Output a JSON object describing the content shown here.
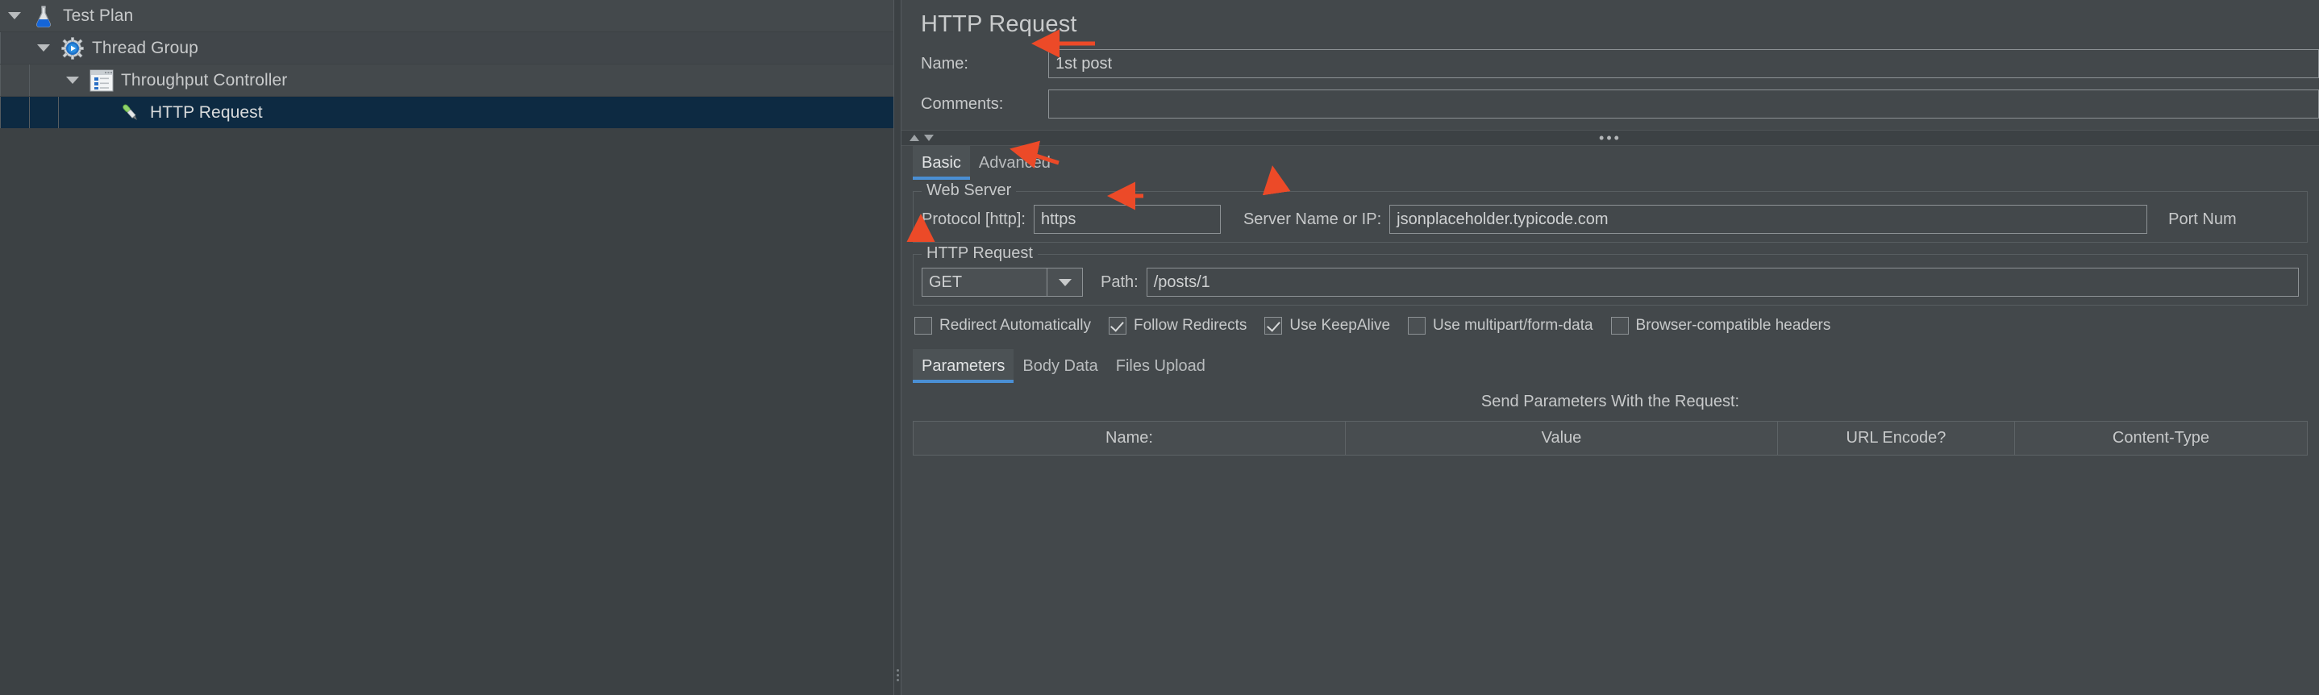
{
  "tree": {
    "name": "test-plan-tree",
    "nodes": [
      {
        "label": "Test Plan",
        "icon": "flask-icon",
        "depth": 0,
        "expanded": true,
        "selected": false
      },
      {
        "label": "Thread Group",
        "icon": "thread-group-gear-icon",
        "depth": 1,
        "expanded": true,
        "selected": false
      },
      {
        "label": "Throughput Controller",
        "icon": "throughput-controller-icon",
        "depth": 2,
        "expanded": true,
        "selected": false
      },
      {
        "label": "HTTP Request",
        "icon": "http-request-pipette-icon",
        "depth": 3,
        "expanded": false,
        "selected": true
      }
    ]
  },
  "panel": {
    "title": "HTTP Request",
    "name_label": "Name:",
    "name_value": "1st post",
    "name_placeholder": "",
    "comments_label": "Comments:",
    "comments_value": "",
    "comments_placeholder": "",
    "tabs": [
      {
        "label": "Basic",
        "active": true
      },
      {
        "label": "Advanced",
        "active": false
      }
    ],
    "web_server": {
      "legend": "Web Server",
      "protocol_label": "Protocol [http]:",
      "protocol_value": "https",
      "server_label": "Server Name or IP:",
      "server_value": "jsonplaceholder.typicode.com",
      "port_label": "Port Num"
    },
    "http_request": {
      "legend": "HTTP Request",
      "method_value": "GET",
      "path_label": "Path:",
      "path_value": "/posts/1"
    },
    "checkboxes": [
      {
        "label": "Redirect Automatically",
        "checked": false
      },
      {
        "label": "Follow Redirects",
        "checked": true
      },
      {
        "label": "Use KeepAlive",
        "checked": true
      },
      {
        "label": "Use multipart/form-data",
        "checked": false
      },
      {
        "label": "Browser-compatible headers",
        "checked": false
      }
    ],
    "body_tabs": [
      {
        "label": "Parameters",
        "active": true
      },
      {
        "label": "Body Data",
        "active": false
      },
      {
        "label": "Files Upload",
        "active": false
      }
    ],
    "params_table": {
      "caption": "Send Parameters With the Request:",
      "columns": [
        "Name:",
        "Value",
        "URL Encode?",
        "Content-Type"
      ],
      "rows": []
    }
  },
  "annotations": {
    "color": "#ec4a28",
    "arrows": [
      {
        "target": "name-field",
        "style": "straight-left"
      },
      {
        "target": "protocol-field",
        "style": "curved-up-left"
      },
      {
        "target": "server-field",
        "style": "short-up"
      },
      {
        "target": "method-combo",
        "style": "short-up"
      },
      {
        "target": "path-field",
        "style": "straight-left"
      }
    ]
  },
  "colors": {
    "window_bg": "#3c4144",
    "panel_bg": "#43484b",
    "tree_row_bg": "#44494c",
    "tree_selected_bg": "#0d2a42",
    "text": "#c7c9ca",
    "border": "#8d9295",
    "tab_accent": "#4a8fd4",
    "annotation_red": "#ec4a28"
  }
}
